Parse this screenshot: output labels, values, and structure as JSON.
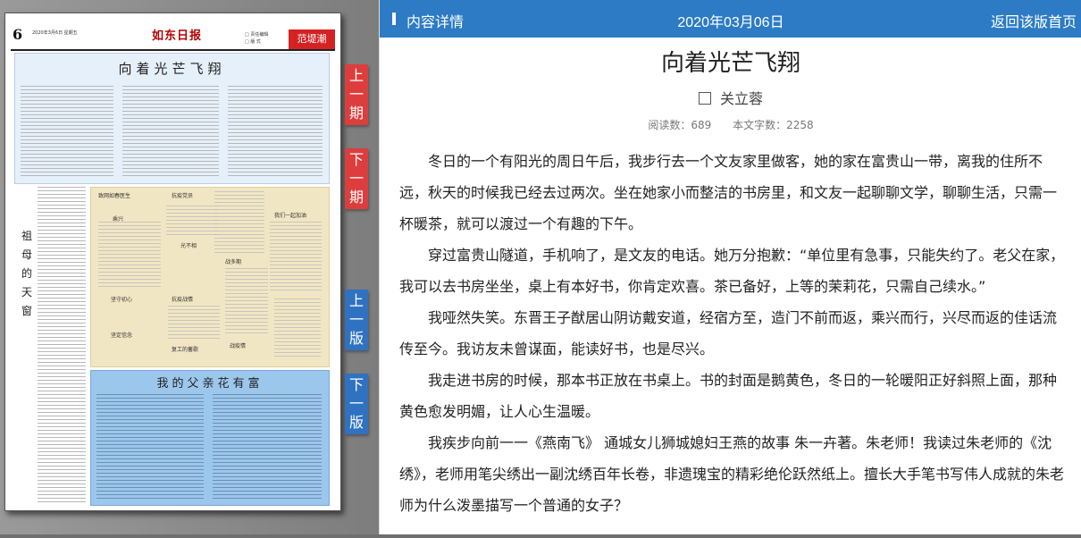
{
  "newspaper": {
    "page_number": "6",
    "date_line": "2020年3月6日 星期五",
    "masthead": "如东日报",
    "section": "范堤潮",
    "checklist": [
      "□ 责任编辑",
      "□ 版 式"
    ],
    "headlines": {
      "main": "向着光芒飞翔",
      "side": "祖母的天窗",
      "bottom": "我的父亲花有富"
    },
    "box_items": [
      "致网如春医生",
      "抗疫党员",
      "乘兴",
      "光不相",
      "我们一起加油",
      "战多期",
      "坚守初心",
      "抗疫战情",
      "坚定信念",
      "战疫情",
      "复工的蓄歌"
    ]
  },
  "nav": {
    "prev_issue": "上一期",
    "next_issue": "下一期",
    "prev_page": "上一版",
    "next_page": "下一版"
  },
  "topbar": {
    "label": "内容详情",
    "date": "2020年03月06日",
    "back": "返回该版首页"
  },
  "article": {
    "title": "向着光芒飞翔",
    "author": "关立蓉",
    "read_count": "阅读数：689",
    "word_count": "本文字数：2258",
    "paragraphs": [
      "冬日的一个有阳光的周日午后，我步行去一个文友家里做客，她的家在富贵山一带，离我的住所不远，秋天的时候我已经去过两次。坐在她家小而整洁的书房里，和文友一起聊聊文学，聊聊生活，只需一杯暖茶，就可以渡过一个有趣的下午。",
      "穿过富贵山隧道，手机响了，是文友的电话。她万分抱歉：“单位里有急事，只能失约了。老父在家，我可以去书房坐坐，桌上有本好书，你肯定欢喜。茶已备好，上等的茉莉花，只需自己续水。”",
      "我哑然失笑。东晋王子猷居山阴访戴安道，经宿方至，造门不前而返，乘兴而行，兴尽而返的佳话流传至今。我访友未曾谋面，能读好书，也是尽兴。",
      "我走进书房的时候，那本书正放在书桌上。书的封面是鹅黄色，冬日的一轮暖阳正好斜照上面，那种黄色愈发明媚，让人心生温暖。",
      "我疾步向前一一《燕南飞》 通城女儿狮城媳妇王燕的故事 朱一卉著。朱老师！我读过朱老师的《沈绣》，老师用笔尖绣出一副沈绣百年长卷，非遗瑰宝的精彩绝伦跃然纸上。擅长大手笔书写伟人成就的朱老师为什么泼墨描写一个普通的女子？"
    ]
  }
}
